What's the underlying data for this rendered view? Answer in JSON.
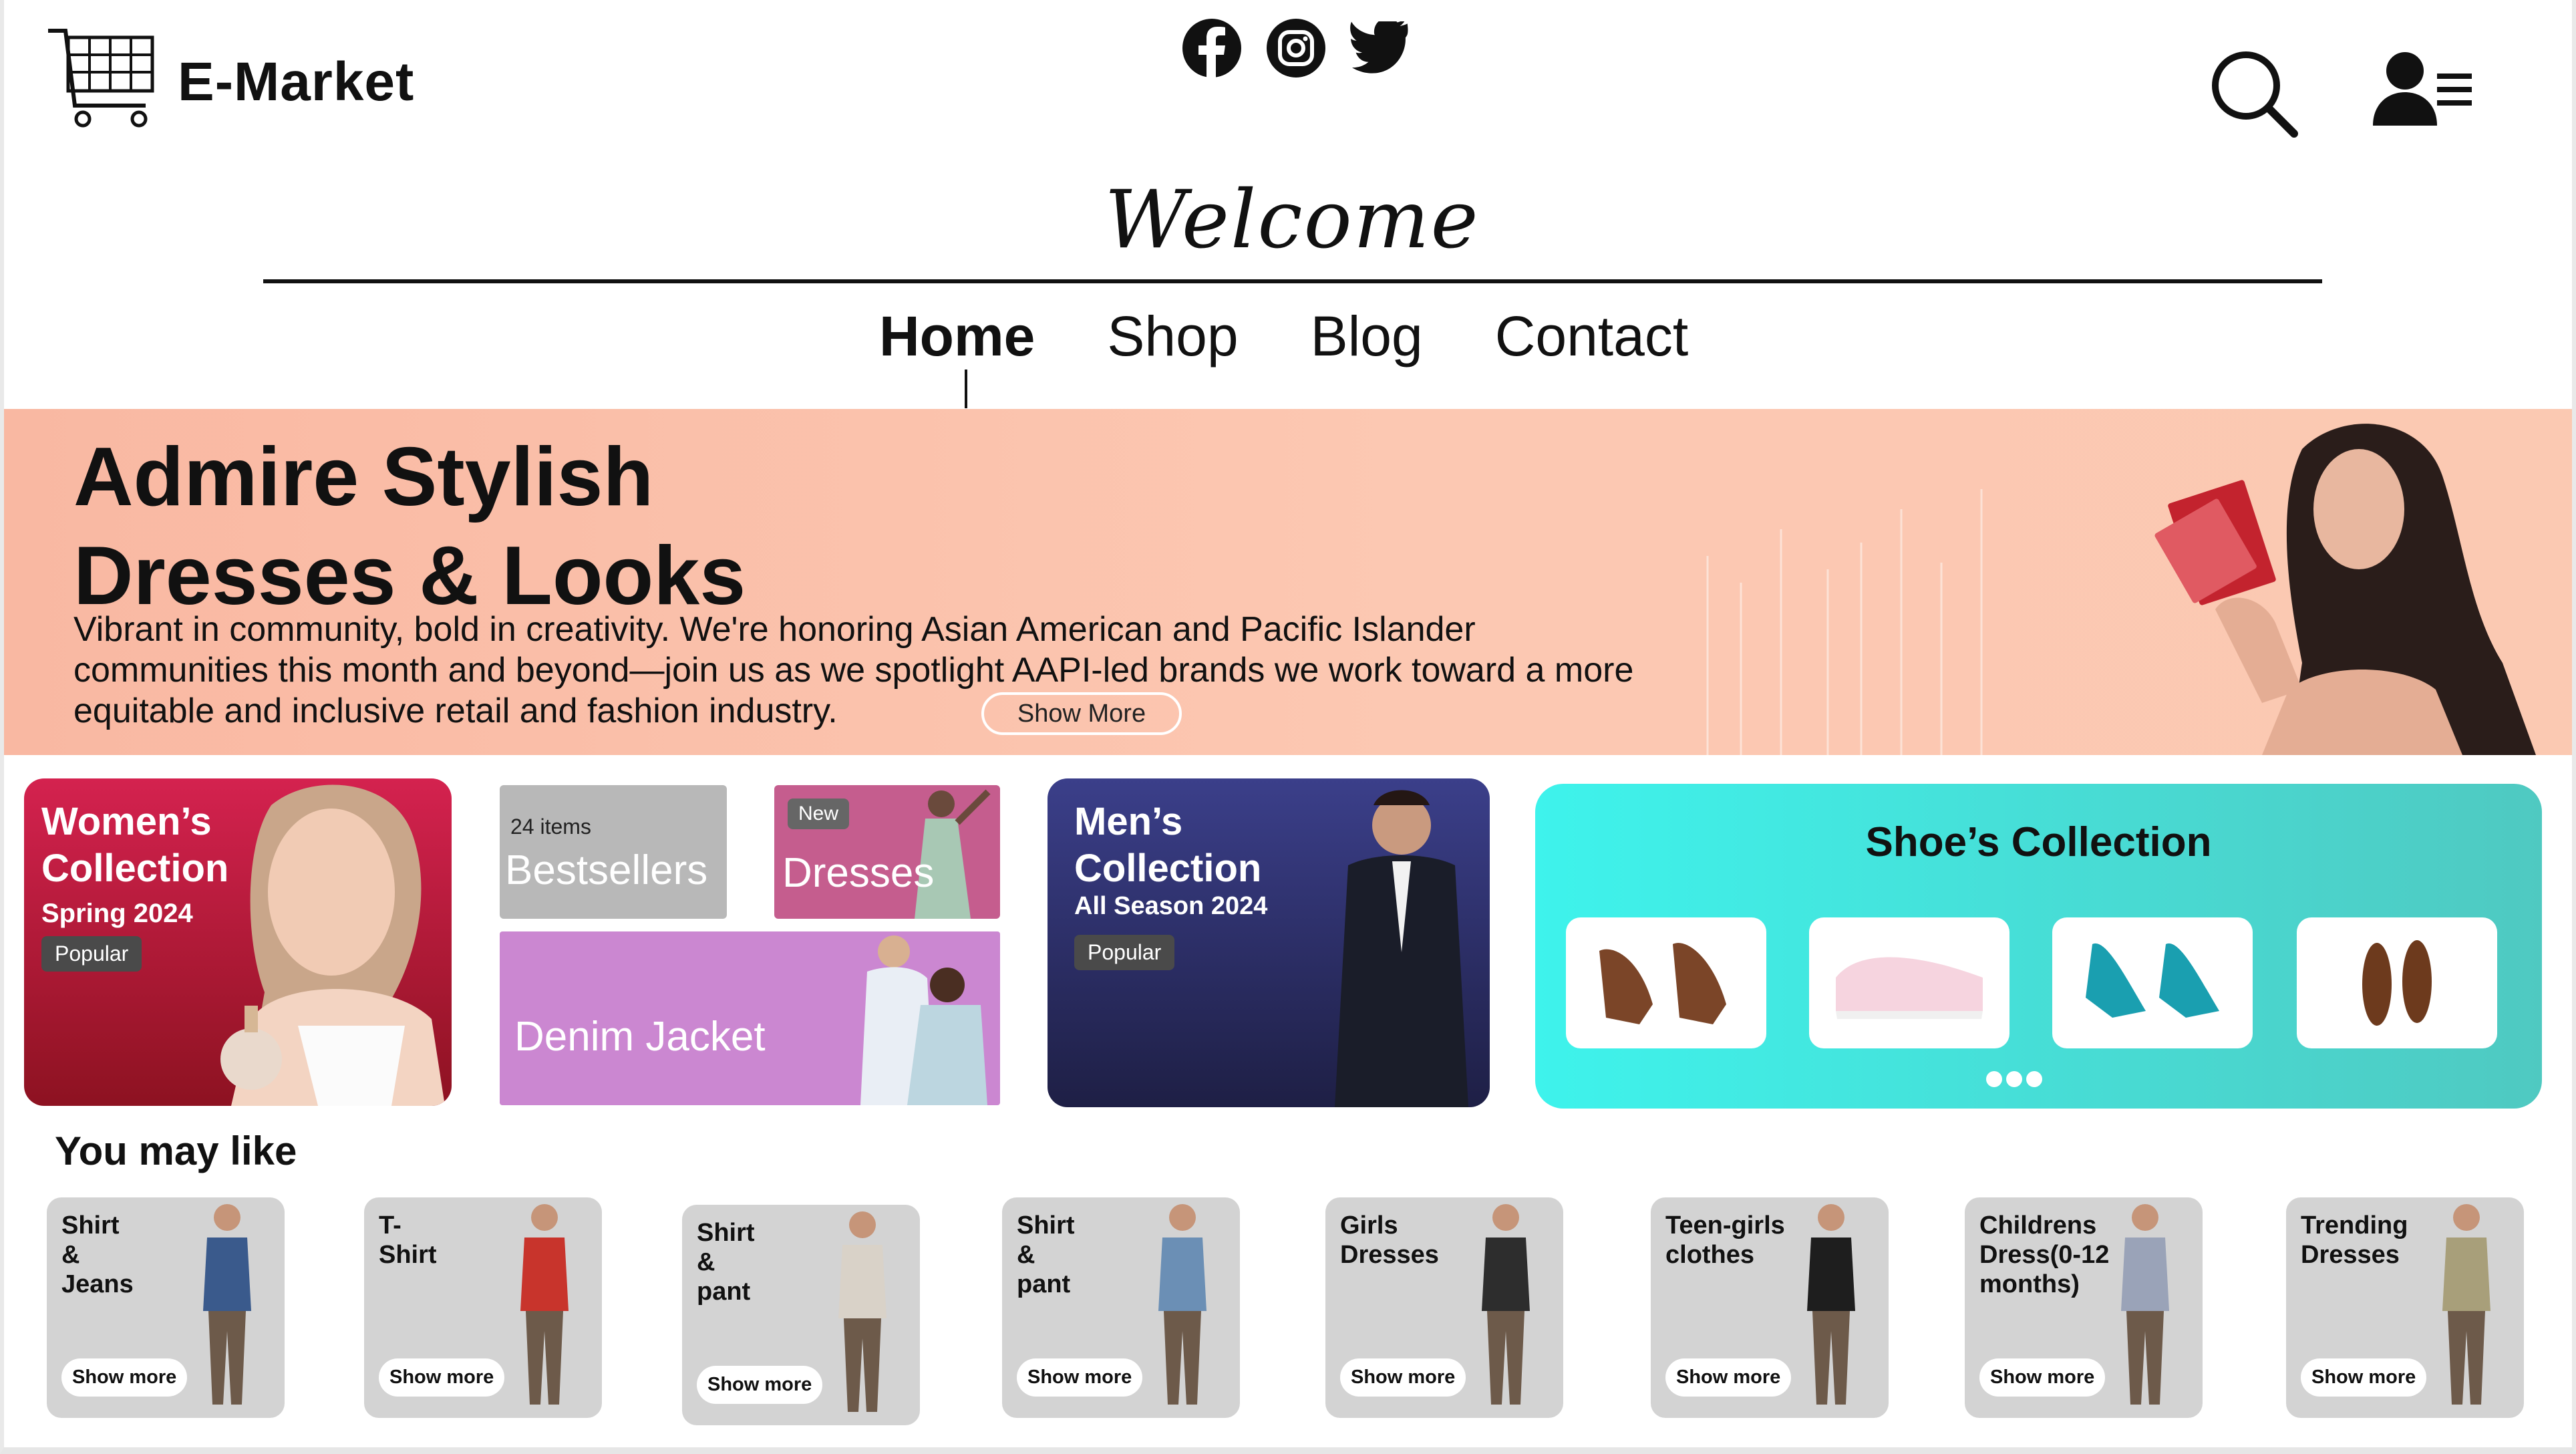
{
  "header": {
    "brand": "E-Market",
    "welcome": "Welcome",
    "social": [
      "facebook-icon",
      "instagram-icon",
      "twitter-icon"
    ]
  },
  "nav": {
    "items": [
      "Home",
      "Shop",
      "Blog",
      "Contact"
    ],
    "active": "Home"
  },
  "hero": {
    "title_line1": "Admire Stylish",
    "title_line2": "Dresses & Looks",
    "text": "Vibrant in community, bold in creativity. We're honoring Asian American and Pacific Islander communities this month and beyond—join us as we spotlight AAPI-led brands we work toward a more equitable and inclusive retail and fashion industry.",
    "button": "Show More",
    "color": "#fbc5ae"
  },
  "collections": {
    "women": {
      "title_line1": "Women’s",
      "title_line2": "Collection",
      "subtitle": "Spring 2024",
      "badge": "Popular",
      "color": "#c81d4c"
    },
    "bestsellers": {
      "count": "24 items",
      "title": "Bestsellers",
      "color": "#b8b8b8"
    },
    "dresses": {
      "badge": "New",
      "title": "Dresses",
      "color": "#c55d8e"
    },
    "denim": {
      "title": "Denim Jacket",
      "color": "#cb87d1"
    },
    "men": {
      "title_line1": "Men’s",
      "title_line2": "Collection",
      "subtitle": "All Season 2024",
      "badge": "Popular",
      "color": "#2b2e66"
    },
    "shoes": {
      "title": "Shoe’s Collection",
      "color": "#3fe6e0"
    }
  },
  "you_may_like": {
    "heading": "You may like",
    "items": [
      {
        "label": "Shirt\n&\nJeans",
        "button": "Show more"
      },
      {
        "label": "T-\nShirt",
        "button": "Show more"
      },
      {
        "label": "Shirt\n&\npant",
        "button": "Show more"
      },
      {
        "label": "Shirt\n&\npant",
        "button": "Show more"
      },
      {
        "label": "Girls\nDresses",
        "button": "Show more"
      },
      {
        "label": "Teen-girls\nclothes",
        "button": "Show more"
      },
      {
        "label": "Childrens\nDress(0-12\nmonths)",
        "button": "Show more"
      },
      {
        "label": "Trending\nDresses",
        "button": "Show more"
      }
    ]
  }
}
